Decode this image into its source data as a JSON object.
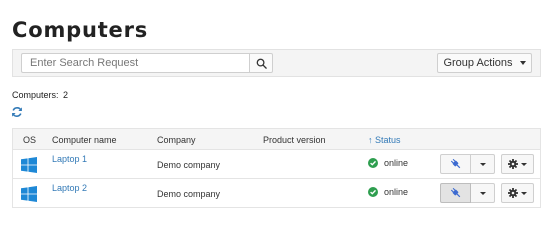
{
  "page": {
    "title": "Computers"
  },
  "toolbar": {
    "search_placeholder": "Enter Search Request",
    "search_icon": "magnifier-icon",
    "group_actions_label": "Group Actions"
  },
  "summary": {
    "label": "Computers:",
    "count": "2",
    "refresh_icon": "refresh-icon"
  },
  "table": {
    "columns": [
      "OS",
      "Computer name",
      "Company",
      "Product version",
      "Status"
    ],
    "sort_indicator": "↑",
    "rows": [
      {
        "os_icon": "windows-icon",
        "name": "Laptop 1",
        "company": "Demo company",
        "product_version": "",
        "status": "online"
      },
      {
        "os_icon": "windows-icon",
        "name": "Laptop 2",
        "company": "Demo company",
        "product_version": "",
        "status": "online"
      }
    ]
  },
  "colors": {
    "link": "#337ab7",
    "online": "#2e9e4f",
    "windows": "#1e88d6",
    "connect_icon": "#3d6bd1"
  }
}
